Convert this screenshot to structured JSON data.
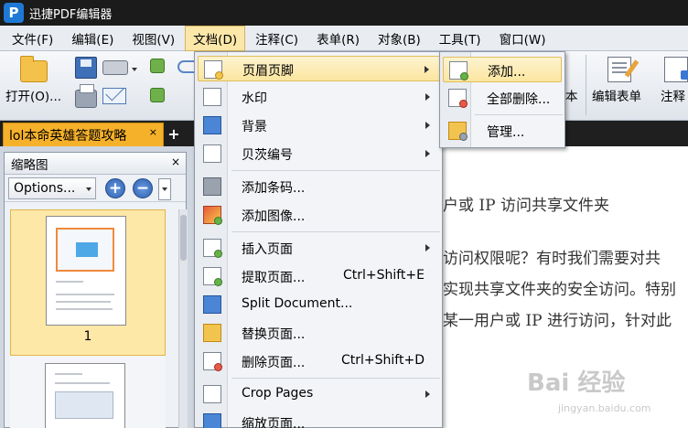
{
  "window": {
    "title": "迅捷PDF编辑器",
    "app_icon_letter": "P"
  },
  "menubar": {
    "items": [
      "文件(F)",
      "编辑(E)",
      "视图(V)",
      "文档(D)",
      "注释(C)",
      "表单(R)",
      "对象(B)",
      "工具(T)",
      "窗口(W)"
    ],
    "active": "文档(D)"
  },
  "toolbar": {
    "open_label": "打开(O)...",
    "convert_text_label": "本",
    "edit_form_label": "编辑表单",
    "annotate_label": "注释"
  },
  "tabs": {
    "doc_tab": "lol本命英雄答题攻略",
    "close": "×",
    "add": "+"
  },
  "thumbnail_panel": {
    "title": "缩略图",
    "close": "×",
    "options_label": "Options...",
    "zoom_in": "+",
    "zoom_out": "−",
    "page_number": "1"
  },
  "document": {
    "lines": [
      "户或 IP 访问共享文件夹",
      "访问权限呢？有时我们需要对共",
      "实现共享文件夹的安全访问。特别",
      "某一用户或 IP 进行访问，针对此"
    ]
  },
  "doc_menu": {
    "items": [
      {
        "label": "页眉页脚",
        "submenu": true,
        "icon": "header-footer-icon"
      },
      {
        "label": "水印",
        "submenu": true,
        "icon": "watermark-icon"
      },
      {
        "label": "背景",
        "submenu": true,
        "icon": "background-icon"
      },
      {
        "label": "贝茨编号",
        "submenu": true,
        "icon": "bates-numbering-icon"
      },
      {
        "label": "添加条码...",
        "icon": "barcode-icon"
      },
      {
        "label": "添加图像...",
        "icon": "add-image-icon"
      },
      {
        "label": "插入页面",
        "submenu": true,
        "icon": "insert-page-icon"
      },
      {
        "label": "提取页面...",
        "shortcut": "Ctrl+Shift+E",
        "icon": "extract-page-icon"
      },
      {
        "label": "Split Document...",
        "icon": "split-document-icon"
      },
      {
        "label": "替换页面...",
        "icon": "replace-page-icon"
      },
      {
        "label": "删除页面...",
        "shortcut": "Ctrl+Shift+D",
        "icon": "delete-page-icon"
      },
      {
        "label": "Crop Pages",
        "submenu": true,
        "icon": "crop-pages-icon"
      },
      {
        "label": "缩放页面...",
        "icon": "resize-page-icon"
      }
    ]
  },
  "header_footer_submenu": {
    "items": [
      "添加...",
      "全部删除...",
      "管理..."
    ]
  },
  "watermark": {
    "text": "Bai 经验",
    "sub": "jingyan.baidu.com"
  }
}
